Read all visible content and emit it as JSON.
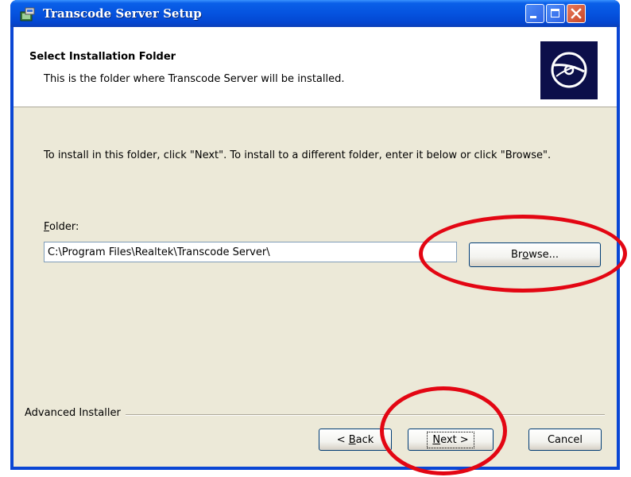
{
  "window": {
    "title": "Transcode Server Setup"
  },
  "banner": {
    "title": "Select Installation Folder",
    "subtitle": "This is the folder where Transcode Server will be installed."
  },
  "content": {
    "instructions": "To install in this folder, click \"Next\". To install to a different folder, enter it below or click \"Browse\".",
    "folder_label_pre": "",
    "folder_label_mnemonic": "F",
    "folder_label_post": "older:",
    "folder_value": "C:\\Program Files\\Realtek\\Transcode Server\\",
    "browse_pre": "Br",
    "browse_mnemonic": "o",
    "browse_post": "wse..."
  },
  "footer": {
    "brand": "Advanced Installer",
    "back_pre": "< ",
    "back_mnemonic": "B",
    "back_post": "ack",
    "next_pre": "",
    "next_mnemonic": "N",
    "next_post": "ext >",
    "cancel": "Cancel"
  },
  "colors": {
    "titlebar": "#0553df",
    "dialog_bg": "#ece9d8",
    "annotation": "#e30613"
  },
  "icons": [
    "installer-app-icon",
    "minimize-icon",
    "maximize-icon",
    "close-icon",
    "cd-disc-icon"
  ]
}
